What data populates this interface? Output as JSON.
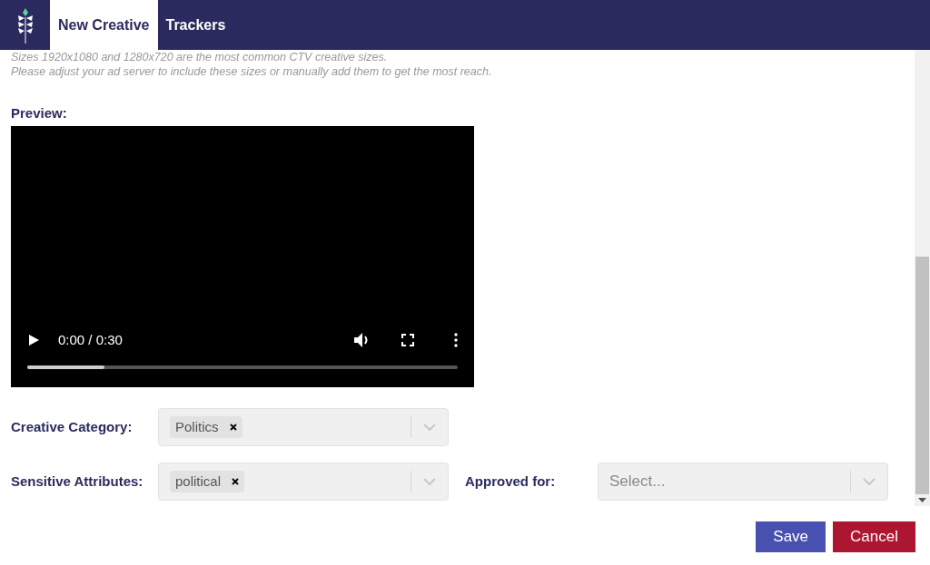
{
  "tabs": [
    {
      "label": "New Creative",
      "selected": true
    },
    {
      "label": "Trackers",
      "selected": false
    }
  ],
  "notes": [
    "Sizes 1920x1080 and 1280x720 are the most common CTV creative sizes.",
    "Please adjust your ad server to include these sizes or manually add them to get the most reach."
  ],
  "preview": {
    "label": "Preview:",
    "time": "0:00 / 0:30",
    "level": 0.18
  },
  "fields": [
    {
      "label": "Creative Category:",
      "tags": [
        "Politics"
      ]
    },
    {
      "label": "Sensitive Attributes:",
      "tags": [
        "political"
      ]
    },
    {
      "label": "Approved for:",
      "placeholder": "Select..."
    }
  ],
  "buttons": [
    {
      "label": "Save",
      "kind": "primary"
    },
    {
      "label": "Cancel",
      "kind": "danger"
    }
  ]
}
